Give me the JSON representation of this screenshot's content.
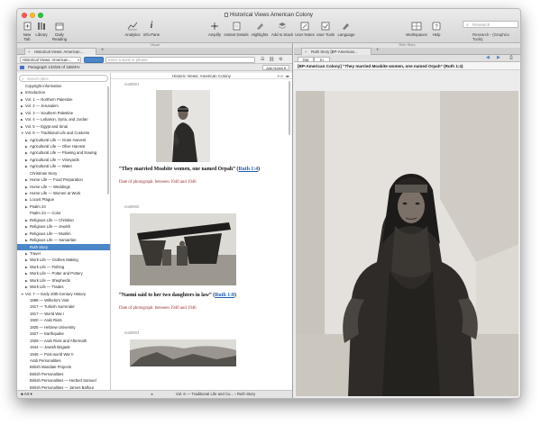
{
  "window": {
    "title": "Historical Views American Colony"
  },
  "toolbar": {
    "items": [
      {
        "label": "New Tab",
        "icon": "new-tab-icon"
      },
      {
        "label": "Library",
        "icon": "library-icon"
      },
      {
        "label": "Daily Reading",
        "icon": "daily-reading-icon"
      },
      {
        "label": "Analytics",
        "icon": "analytics-icon"
      },
      {
        "label": "Info Pane",
        "icon": "info-icon"
      },
      {
        "label": "Amplify",
        "icon": "amplify-icon"
      },
      {
        "label": "Instant Details",
        "icon": "instant-details-icon"
      },
      {
        "label": "Highlights",
        "icon": "highlights-icon"
      },
      {
        "label": "Add to Stack",
        "icon": "stack-icon"
      },
      {
        "label": "User Notes",
        "icon": "user-notes-icon"
      },
      {
        "label": "User Tools",
        "icon": "user-tools-icon"
      },
      {
        "label": "Language",
        "icon": "language-icon"
      },
      {
        "label": "Workspaces",
        "icon": "workspaces-icon"
      },
      {
        "label": "Help",
        "icon": "help-icon"
      }
    ],
    "search_placeholder": "Research",
    "search_scope": "Research - (Graphics Tools)"
  },
  "left_pane": {
    "label": "Visual",
    "tab": "Historical Views: American...",
    "resource_select": "Historical Views: American...",
    "word_input_placeholder": "Enter a word or phrase",
    "paragraph": "Paragraph 133/28 of 168/4%",
    "add_notes": "Add Notes",
    "toc_search_placeholder": "Search titles",
    "toc": [
      {
        "label": "Copyright information",
        "tri": ""
      },
      {
        "label": "Introduction",
        "tri": "▶"
      },
      {
        "label": "Vol. 1 — Northern Palestine",
        "tri": "▶"
      },
      {
        "label": "Vol. 2 — Jerusalem",
        "tri": "▶"
      },
      {
        "label": "Vol. 3 — Southern Palestine",
        "tri": "▶"
      },
      {
        "label": "Vol. 4 — Lebanon, Syria, and Jordan",
        "tri": "▶"
      },
      {
        "label": "Vol. 5 — Egypt and Sinai",
        "tri": "▶"
      },
      {
        "label": "Vol. 6 — Traditional Life and Customs",
        "tri": "▼"
      },
      {
        "label": "  Agricultural Life — Grain Harvest",
        "tri": "▶"
      },
      {
        "label": "  Agricultural Life — Olive Harvest",
        "tri": "▶"
      },
      {
        "label": "  Agricultural Life — Plowing and Sowing",
        "tri": "▶"
      },
      {
        "label": "  Agricultural Life — Vineyards",
        "tri": "▶"
      },
      {
        "label": "  Agricultural Life — Water",
        "tri": "▶"
      },
      {
        "label": "  Christmas Story",
        "tri": ""
      },
      {
        "label": "  Home Life — Food Preparation",
        "tri": "▶"
      },
      {
        "label": "  Home Life — Weddings",
        "tri": "▶"
      },
      {
        "label": "  Home Life — Women at Work",
        "tri": "▶"
      },
      {
        "label": "  Locust Plague",
        "tri": "▶"
      },
      {
        "label": "  Psalm 23",
        "tri": "▶"
      },
      {
        "label": "  Psalm 23 — Color",
        "tri": ""
      },
      {
        "label": "  Religious Life — Christian",
        "tri": "▶"
      },
      {
        "label": "  Religious Life — Jewish",
        "tri": "▶"
      },
      {
        "label": "  Religious Life — Muslim",
        "tri": "▶"
      },
      {
        "label": "  Religious Life — Samaritan",
        "tri": "▶"
      },
      {
        "label": "  Ruth Story",
        "tri": ""
      },
      {
        "label": "  Travel",
        "tri": "▶"
      },
      {
        "label": "  Work Life — Clothes Making",
        "tri": "▶"
      },
      {
        "label": "  Work Life — Fishing",
        "tri": "▶"
      },
      {
        "label": "  Work Life — Potter and Pottery",
        "tri": "▶"
      },
      {
        "label": "  Work Life — Shepherds",
        "tri": "▶"
      },
      {
        "label": "  Work Life — Trades",
        "tri": "▶"
      },
      {
        "label": "Vol. 7 — Early 20th-Century History",
        "tri": "▼"
      },
      {
        "label": "  1898 — Wilhelm's Visit",
        "tri": ""
      },
      {
        "label": "  1917 — Turkish Surrender",
        "tri": ""
      },
      {
        "label": "  1917 — World War I",
        "tri": ""
      },
      {
        "label": "  1920 — Arab Riots",
        "tri": ""
      },
      {
        "label": "  1925 — Hebrew University",
        "tri": ""
      },
      {
        "label": "  1927 — Earthquake",
        "tri": ""
      },
      {
        "label": "  1929 — Arab Riots and Aftermath",
        "tri": ""
      },
      {
        "label": "  1944 — Jewish Brigade",
        "tri": ""
      },
      {
        "label": "  1945 — Post-world War II",
        "tri": ""
      },
      {
        "label": "  Arab Personalities",
        "tri": ""
      },
      {
        "label": "  British Mandate Projects",
        "tri": ""
      },
      {
        "label": "  British Personalities",
        "tri": ""
      },
      {
        "label": "  British Personalities — Herbert Samuel",
        "tri": ""
      },
      {
        "label": "  British Personalities — James Balfour",
        "tri": ""
      },
      {
        "label": "  British Personalities — Winston Churchill",
        "tri": ""
      }
    ],
    "footer_left": "Art",
    "footer_breadcrumb": "Vol. 6 — Traditional Life and Cu... › Ruth Story",
    "reader": {
      "header": "Historic Views: American Colony",
      "items": [
        {
          "ref": "mat0901",
          "caption": "“They married Moabite women, one named Orpah”",
          "link": "Ruth 1:4",
          "date": "Date of photograph: between 1940 and 1946"
        },
        {
          "ref": "mat0902",
          "caption": "“Naomi said to her two daughters in law”",
          "link": "Ruth 1:8",
          "date": "Date of photograph: between 1940 and 1946"
        },
        {
          "ref": "mat0903",
          "caption": "",
          "link": "",
          "date": ""
        }
      ]
    }
  },
  "right_pane": {
    "label": "Ruth Story",
    "tab": "Ruth Story [BP-American...",
    "out_label": "Out",
    "in_label": "In",
    "title": "[BP-American Colony] “They married Moabite women, one named Orpah” (Ruth 1:4)"
  },
  "colors": {
    "selection": "#4a86c8",
    "link": "#1a5cb0",
    "date": "#9c2b2b"
  }
}
